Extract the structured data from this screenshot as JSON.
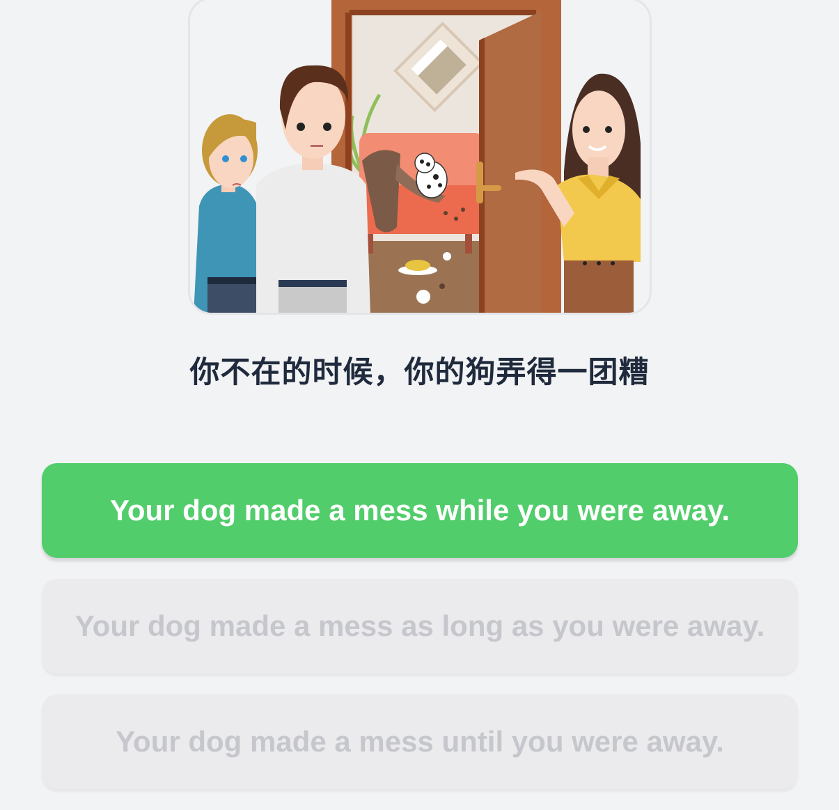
{
  "illustration": {
    "icon": "scene-illustration-dog-mess",
    "colors": {
      "door": "#b5653a",
      "wall": "#ece5dd",
      "couch": "#f28c72",
      "floor": "#9b7353"
    }
  },
  "prompt": {
    "text": "你不在的时候，你的狗弄得一团糟"
  },
  "options": [
    {
      "label": "Your dog made a mess while you were away.",
      "state": "selected"
    },
    {
      "label": "Your dog made a mess as long as you were away.",
      "state": "disabled"
    },
    {
      "label": "Your dog made a mess until you were away.",
      "state": "disabled"
    }
  ],
  "colors": {
    "selected": "#52cd6b",
    "disabled_bg": "#ebebed",
    "disabled_text": "#c5c7cc",
    "prompt_text": "#1f2a3c",
    "background": "#f2f3f5"
  }
}
